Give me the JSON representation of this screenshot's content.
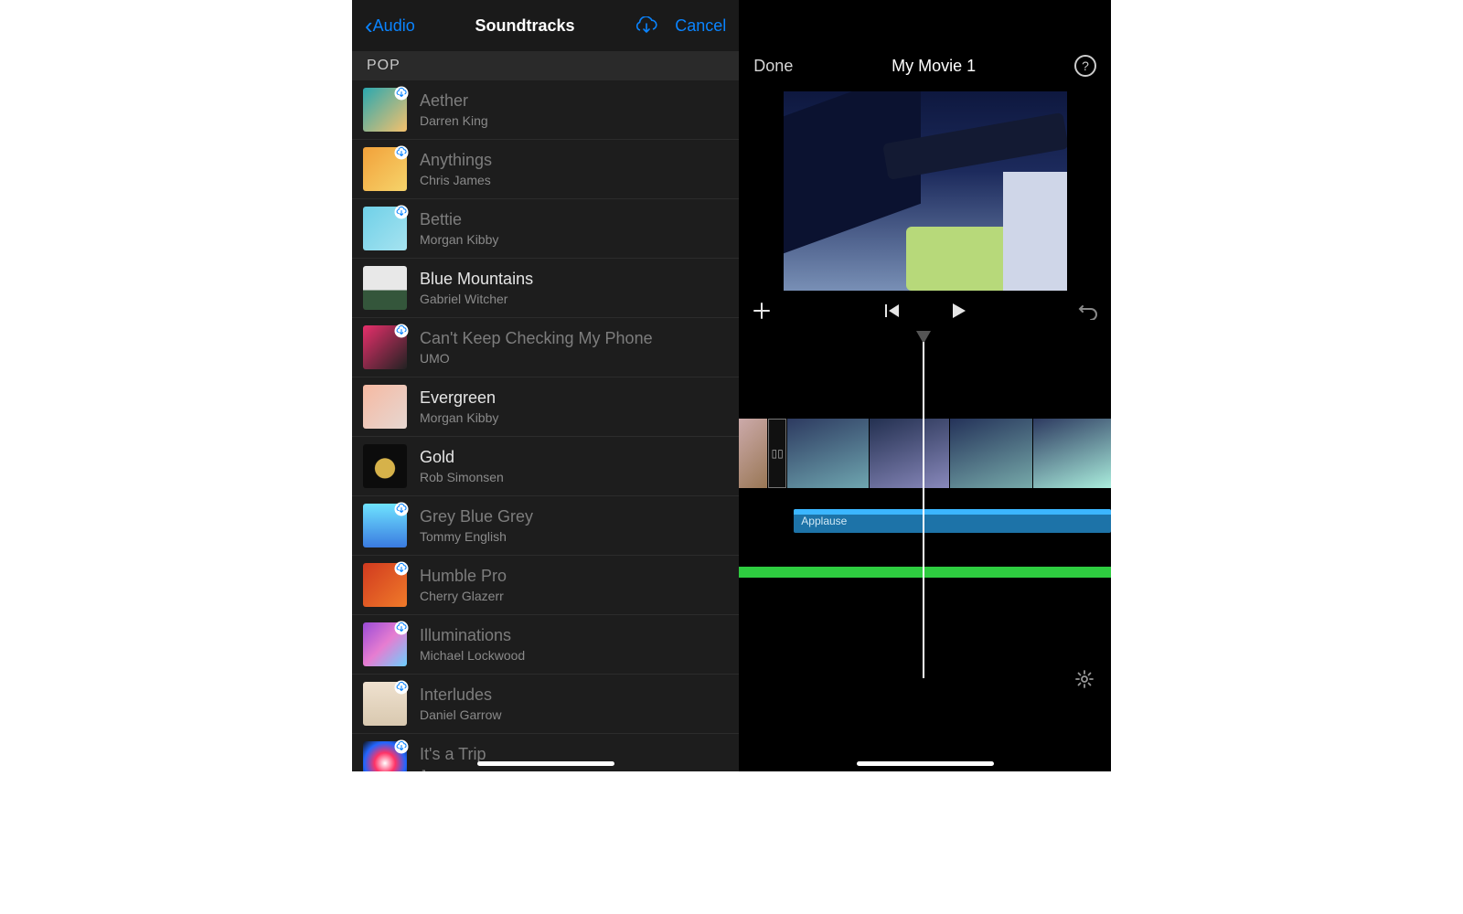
{
  "left": {
    "back_label": "Audio",
    "title": "Soundtracks",
    "cancel": "Cancel",
    "section": "POP",
    "tracks": [
      {
        "title": "Aether",
        "artist": "Darren King",
        "dim": true,
        "cloud": true,
        "thumb": "linear-gradient(135deg,#2aa8b0,#f5c16c)"
      },
      {
        "title": "Anythings",
        "artist": "Chris James",
        "dim": true,
        "cloud": true,
        "thumb": "linear-gradient(135deg,#f2a13a,#f6d46b)"
      },
      {
        "title": "Bettie",
        "artist": "Morgan Kibby",
        "dim": true,
        "cloud": true,
        "thumb": "linear-gradient(135deg,#6fd0e8,#a6e3f0)"
      },
      {
        "title": "Blue Mountains",
        "artist": "Gabriel Witcher",
        "dim": false,
        "cloud": false,
        "thumb": "linear-gradient(180deg,#e8e8e8 55%,#34563b 55%)"
      },
      {
        "title": "Can't Keep Checking My Phone",
        "artist": "UMO",
        "dim": true,
        "cloud": true,
        "thumb": "linear-gradient(135deg,#e72f6b,#222)"
      },
      {
        "title": "Evergreen",
        "artist": "Morgan Kibby",
        "dim": false,
        "cloud": false,
        "thumb": "linear-gradient(135deg,#f6b9a2,#e6d7d1)"
      },
      {
        "title": "Gold",
        "artist": "Rob Simonsen",
        "dim": false,
        "cloud": false,
        "thumb": "radial-gradient(circle at 50% 55%,#d6b24a 0 30%,#0c0c0c 32%)"
      },
      {
        "title": "Grey Blue Grey",
        "artist": "Tommy English",
        "dim": true,
        "cloud": true,
        "thumb": "linear-gradient(180deg,#6fe3ff,#3a7be0)"
      },
      {
        "title": "Humble Pro",
        "artist": "Cherry Glazerr",
        "dim": true,
        "cloud": true,
        "thumb": "linear-gradient(135deg,#d13a1f,#f07b2a)"
      },
      {
        "title": "Illuminations",
        "artist": "Michael Lockwood",
        "dim": true,
        "cloud": true,
        "thumb": "linear-gradient(135deg,#9a4bd6,#e67dd1,#6bd0ff)"
      },
      {
        "title": "Interludes",
        "artist": "Daniel Garrow",
        "dim": true,
        "cloud": true,
        "thumb": "linear-gradient(180deg,#efe1cf,#d9c9b0)"
      },
      {
        "title": "It's a Trip",
        "artist": "Joywave",
        "dim": true,
        "cloud": true,
        "thumb": "radial-gradient(circle,#fff,#f36,#26f,#111)"
      }
    ]
  },
  "right": {
    "done": "Done",
    "title": "My Movie 1",
    "sound_label": "Applause"
  }
}
